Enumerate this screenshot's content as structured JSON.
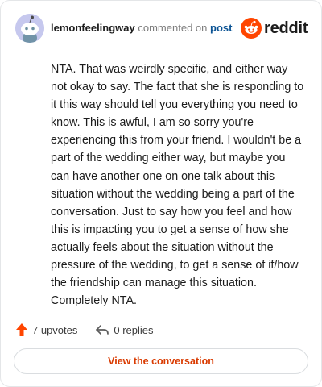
{
  "comment": {
    "author": "lemonfeelingway",
    "action_text": "commented on",
    "target_link": "post",
    "body": "NTA. That was weirdly specific, and either way not okay to say. The fact that she is responding to it this way should tell you everything you need to know. This is awful, I am so sorry you're experiencing this from your friend. I wouldn't be a part of the wedding either way, but maybe you can have another one on one talk about this situation without the wedding being a part of the conversation. Just to say how you feel and how this is impacting you to get a sense of how she actually feels about the situation without the pressure of the wedding, to get a sense of if/how the friendship can manage this situation. Completely NTA.",
    "upvotes_label": "7 upvotes",
    "replies_label": "0 replies",
    "view_button_label": "View the conversation"
  },
  "brand": {
    "name": "reddit",
    "accent_color": "#ff4500"
  },
  "icons": {
    "avatar": "snoo-avatar-icon",
    "logo": "reddit-logo-icon",
    "upvote": "upvote-arrow-icon",
    "reply": "reply-arrow-icon"
  },
  "colors": {
    "upvote_arrow": "#ff4500",
    "view_button_text": "#d93a00",
    "link": "#0b5394"
  }
}
